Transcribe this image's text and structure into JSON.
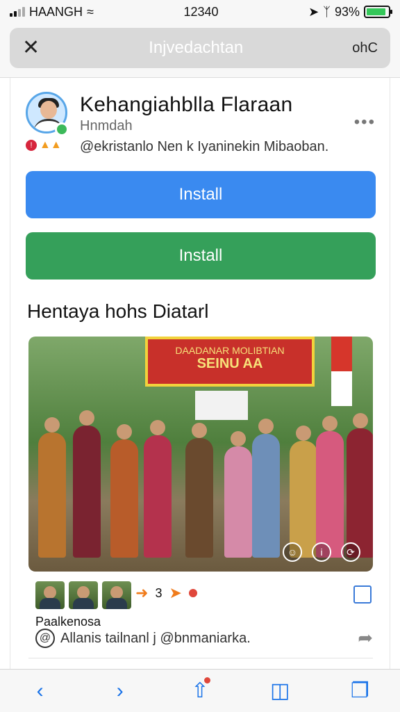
{
  "status_bar": {
    "carrier": "ΗΑΑΝGΗ",
    "time": "12340",
    "battery": "93%"
  },
  "url_bar": {
    "title": "Injvedachtan",
    "right_label": "ohC"
  },
  "post": {
    "author_name": "Kehangiahblla Flaraan",
    "subtitle": "Hnmdah",
    "handle_line": "@ekristanlo Nen k Iyaninekin Mibaoban.",
    "badge": "!",
    "primary_button": "Install",
    "secondary_button": "Install",
    "section_title": "Hentaya hohs Diatarl",
    "photo": {
      "banner_line1": "DAADANAR MOLIBTIAN",
      "banner_line2": "SEINU AA"
    },
    "reaction_count": "3",
    "caption_title": "Paalkenosa",
    "caption_text": "Allanis tailnanl j @bnmaniarka."
  },
  "colors": {
    "install_blue": "#3a8af0",
    "install_green": "#35a05a",
    "toolbar_tint": "#1a73e8"
  }
}
